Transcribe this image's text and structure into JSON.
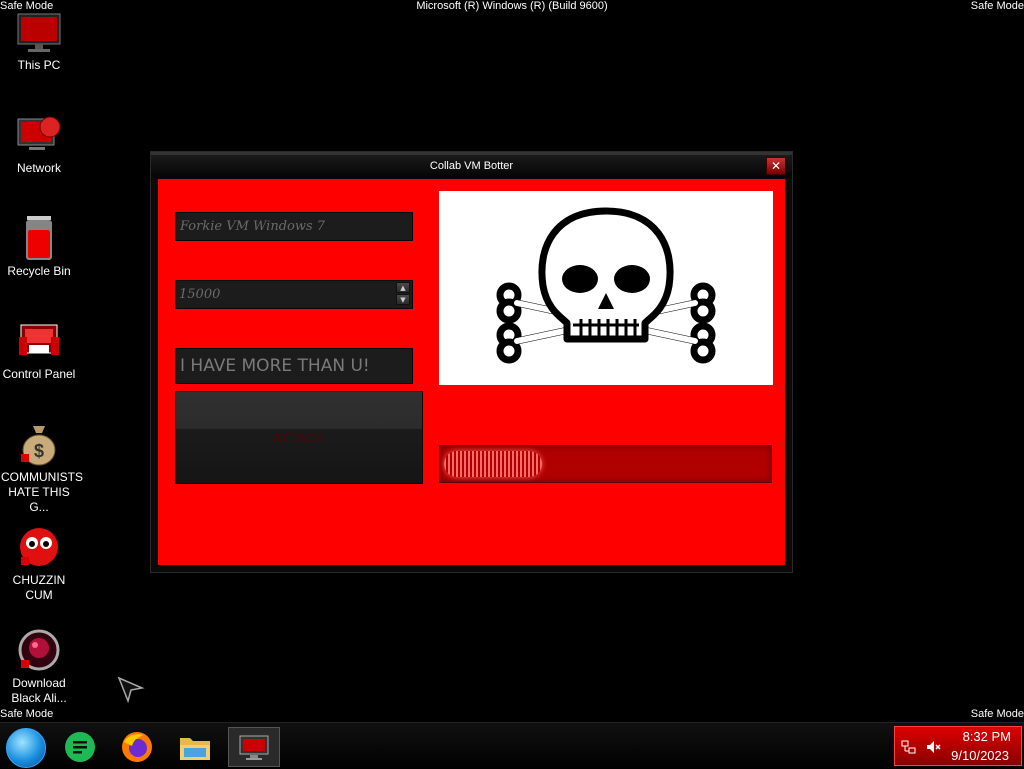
{
  "screen": {
    "corner_text": "Safe Mode",
    "build_text": "Microsoft (R) Windows (R) (Build 9600)"
  },
  "desktop_icons": [
    {
      "label": "This PC",
      "icon": "monitor-icon"
    },
    {
      "label": "Network",
      "icon": "network-icon"
    },
    {
      "label": "Recycle Bin",
      "icon": "recycle-bin-icon"
    },
    {
      "label": "Control Panel",
      "icon": "control-panel-icon"
    },
    {
      "label": "COMMUNISTS HATE THIS G...",
      "icon": "money-bag-icon"
    },
    {
      "label": "CHUZZIN CUM",
      "icon": "chuzzle-icon"
    },
    {
      "label": "Download Black Ali...",
      "icon": "alien-orb-icon"
    }
  ],
  "window": {
    "title": "Collab VM Botter",
    "vm_name_value": "Forkie VM Windows 7",
    "count_value": "15000",
    "message_value": "I HAVE MORE THAN U!",
    "attack_label": "ATTACK",
    "image_icon": "skull-crossbones-icon",
    "progress_fraction": 0.3
  },
  "taskbar": {
    "apps": [
      {
        "name": "start-button",
        "icon": "start-orb-icon"
      },
      {
        "name": "notes-app",
        "icon": "notes-icon"
      },
      {
        "name": "firefox-app",
        "icon": "firefox-icon"
      },
      {
        "name": "explorer-app",
        "icon": "folder-icon"
      },
      {
        "name": "collab-vm-botter-app",
        "icon": "monitor-icon"
      }
    ],
    "time": "8:32 PM",
    "date": "9/10/2023",
    "tray_icons": [
      "network-disconnected-icon",
      "volume-muted-icon"
    ]
  },
  "colors": {
    "client_bg": "#ff0000",
    "tray_bg": "#cc0000"
  }
}
